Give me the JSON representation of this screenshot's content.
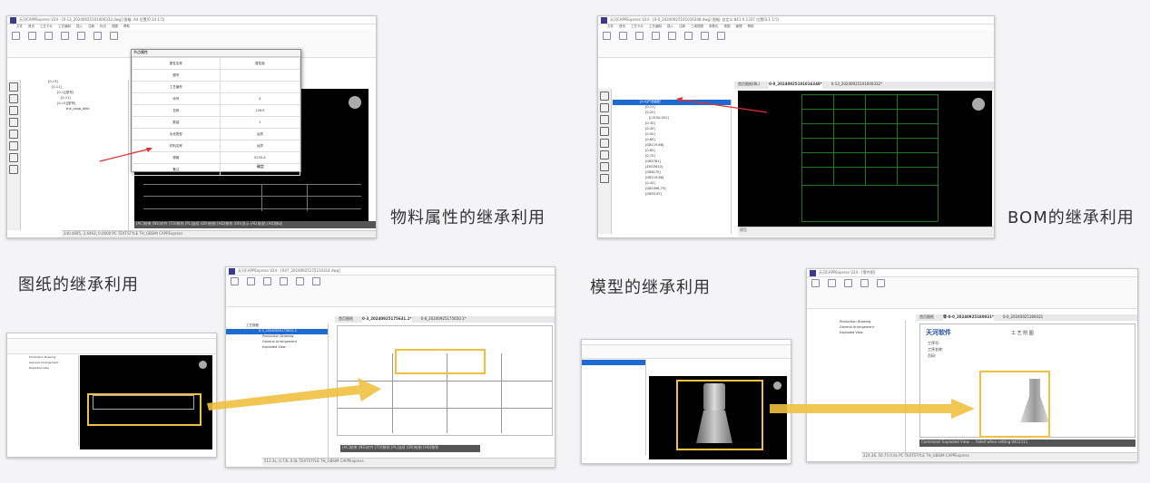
{
  "captions": {
    "material": "物料属性的继承利用",
    "bom": "BOM的继承利用",
    "drawing": "图纸的继承利用",
    "model": "模型的继承利用"
  },
  "shot1": {
    "title": "天河CAPPExpress V24 - [0-13_20240925101000332.dwg] 图幅: A4 位置(0.14 1:5)",
    "menu": [
      "文件",
      "首页",
      "工艺卡片",
      "工艺编制",
      "插入",
      "注释",
      "标记",
      "视图",
      "帮助"
    ],
    "dialog_title": "节点属性",
    "dialog_rows": [
      [
        "属性名称",
        "属性值"
      ],
      [
        "图号",
        ""
      ],
      [
        "工艺编号",
        ""
      ],
      [
        "序号",
        "4"
      ],
      [
        "名称",
        "126.9"
      ],
      [
        "数量",
        "1"
      ],
      [
        "毛坯类型",
        "台质"
      ],
      [
        "材料名称",
        "台质"
      ],
      [
        "规格",
        "0235-A"
      ],
      [
        "备注",
        ""
      ]
    ],
    "dialog_ok": "确定",
    "tree_items": [
      "[0-13]",
      "[0-11]",
      "[0-1][型号]",
      "[0-11]",
      "[0-13][型号]",
      "the_capp_defa"
    ],
    "command_line": "[AC]结束 [NS]对齐 [TO]移到 [PL]连续 (DR)绘制 [HD]移到 (OR)显示 (AD]粘贴 [AD]移动",
    "status": "240.4695, 2.6493, 0.0000  PC  TEXTSTYLE  TH_GBSIM  CAPPExpress"
  },
  "shot2": {
    "title": "天河CAPPExpress V24 - [0-0_20240925101016348.dwg] 图幅: 自定义 841 X 1337 位置(0.1 1:5)",
    "menu": [
      "文件",
      "首页",
      "工艺卡片",
      "工艺编制",
      "插入",
      "注释",
      "三维视图",
      "参数化",
      "视图",
      "管理",
      "帮助"
    ],
    "tree_selected": "[0-0]产品装配",
    "tree_items": [
      "[0-11]",
      "[0-20]",
      "[L315A-001]",
      "[0-30]",
      "[0-40]",
      "[0-50]",
      "[0-60]",
      "[GB119-86]",
      "[0-62]",
      "[0-70]",
      "[GB5781]",
      "[ZXG5610]",
      "[GB6170]",
      "[GB119-86]",
      "[0-42]",
      "[GB1096-79]",
      "[GB93-87]"
    ],
    "cad_tabs": [
      "首页图纸(BL)",
      "0-0_20240925101016348*",
      "0-13_20240925101000332*"
    ],
    "bottom_tab": "模型"
  },
  "shot3": {
    "title": "天河CAPPExpress V24 - [X47_20240925175210314.dwg]",
    "tab_active": "0-3_20240925175631.1",
    "cad_tabs": [
      "首页图纸",
      "0-3_20240925175631.1*",
      "0-8_20240925175650.1*"
    ],
    "command_line": "[AC]结束 [NS]对齐 [TO]移到 [PL]连续 (DR)绘制 [HD]移到",
    "status": "512.3L, 0.73L  0.0L  TEXTSTYLE  TH_GBSIM  CAPPExpress",
    "tree_items": [
      "Production Drawing",
      "General Arrangement",
      "Exploded View"
    ]
  },
  "shot4": {
    "title": "天河CAPPExpress V24 - [零件图]",
    "brand_name": "天河软件",
    "paper_lines": [
      "工 艺 附 图",
      "工序号:",
      "工序名称:",
      "页码:"
    ],
    "cad_tabs": [
      "首页图纸",
      "零-0-0_20240925180031*",
      "0-0_20240925180031"
    ],
    "command_line": "Command: Exploded View: ... failed when setting 0412111",
    "status": "224.36, 56.75  0.0L  PC  TEXTSTYLE  TH_GBSIM  CAPPExpress",
    "tree_items": [
      "Production Drawing",
      "General Arrangement",
      "Exploded View"
    ]
  },
  "colors": {
    "arrow_red": "#e03030",
    "arrow_yellow": "#f0c040",
    "canvas_bg": "#000000",
    "cad_green": "#1f7a1f",
    "selection_blue": "#1e6ad0"
  }
}
